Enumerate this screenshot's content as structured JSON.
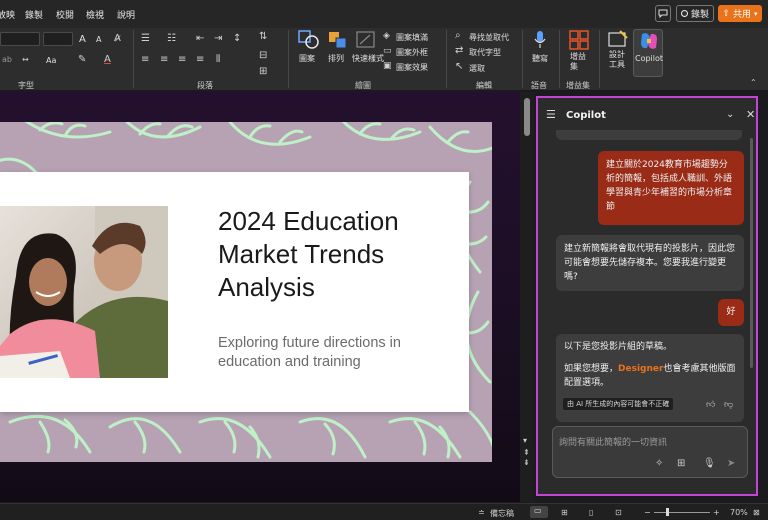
{
  "menu": {
    "items": [
      "放映",
      "錄製",
      "校閱",
      "檢視",
      "說明"
    ]
  },
  "top_buttons": {
    "comment_icon": "comment-icon",
    "record_label": "錄製",
    "share_label": "共用"
  },
  "ribbon": {
    "font_group_label": "字型",
    "paragraph_group_label": "段落",
    "drawing_group_label": "繪圖",
    "editing_group_label": "編輯",
    "voice_group_label": "語音",
    "addins_group_label": "增益集",
    "shapes_label": "圖案",
    "arrange_label": "排列",
    "quick_styles_label": "快速樣式",
    "shape_fill_label": "圖案填滿",
    "shape_outline_label": "圖案外框",
    "shape_effects_label": "圖案效果",
    "find_replace_label": "尋找並取代",
    "replace_label": "取代字型",
    "select_label": "選取",
    "dictate_label": "聽寫",
    "addins_label": "增益集",
    "designer_label": "設計工具",
    "copilot_label": "Copilot",
    "font_size_up": "A",
    "font_size_down": "A",
    "text_effects": "Aa"
  },
  "slide": {
    "title": "2024 Education Market Trends Analysis",
    "subtitle": "Exploring future directions in education and training"
  },
  "copilot": {
    "header_title": "Copilot",
    "messages": [
      {
        "role": "user",
        "text": "建立關於2024教育市場趨勢分析的簡報，包括成人職訓、外語學習與青少年補習的市場分析章節"
      },
      {
        "role": "ai",
        "text": "建立新簡報將會取代現有的投影片，因此您可能會想要先儲存複本。您要我進行變更嗎?"
      },
      {
        "role": "user",
        "text": "好"
      },
      {
        "role": "ai",
        "text_intro": "以下是您投影片組的草稿。",
        "text_before": "如果您想要，",
        "designer_link": "Designer",
        "text_after": "也會考慮其他版面配置選項。",
        "disclaimer": "由 AI 所生成的內容可能會不正確"
      }
    ],
    "input_placeholder": "詢問有關此簡報的一切資訊"
  },
  "status": {
    "notes_label": "備忘稿",
    "zoom_level": "70%"
  },
  "colors": {
    "accent_orange": "#e8731b",
    "copilot_border": "#c445d4",
    "user_bubble": "#9a2b17",
    "slide_bg": "#b6a2b3",
    "leaf_green": "#bff0c7"
  }
}
